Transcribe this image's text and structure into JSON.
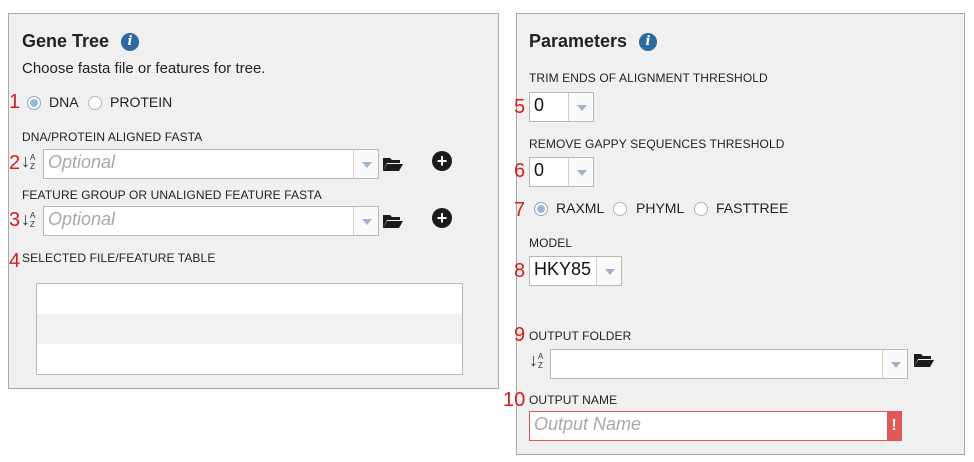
{
  "gene_tree": {
    "title": "Gene Tree",
    "subtitle": "Choose fasta file or features for tree.",
    "radios": [
      {
        "label": "DNA",
        "selected": true
      },
      {
        "label": "PROTEIN",
        "selected": false
      }
    ],
    "aligned_fasta": {
      "label": "DNA/PROTEIN ALIGNED FASTA",
      "placeholder": "Optional"
    },
    "feature_group": {
      "label": "FEATURE GROUP OR UNALIGNED FEATURE FASTA",
      "placeholder": "Optional"
    },
    "table": {
      "label": "SELECTED FILE/FEATURE TABLE",
      "rows": [
        "",
        "",
        ""
      ]
    }
  },
  "parameters": {
    "title": "Parameters",
    "trim_ends": {
      "label": "TRIM ENDS OF ALIGNMENT THRESHOLD",
      "value": "0"
    },
    "gappy": {
      "label": "REMOVE GAPPY SEQUENCES THRESHOLD",
      "value": "0"
    },
    "methods": [
      {
        "label": "RAXML",
        "selected": true
      },
      {
        "label": "PHYML",
        "selected": false
      },
      {
        "label": "FASTTREE",
        "selected": false
      }
    ],
    "model": {
      "label": "MODEL",
      "value": "HKY85"
    },
    "output_folder": {
      "label": "OUTPUT FOLDER",
      "value": ""
    },
    "output_name": {
      "label": "OUTPUT NAME",
      "placeholder": "Output Name",
      "error_glyph": "!"
    }
  },
  "markers": [
    "1",
    "2",
    "3",
    "4",
    "5",
    "6",
    "7",
    "8",
    "9",
    "10"
  ],
  "colors": {
    "marker": "#d21f1f",
    "info": "#2c6aa0",
    "radio_selected": "#9bb7d6",
    "error": "#e05858"
  }
}
